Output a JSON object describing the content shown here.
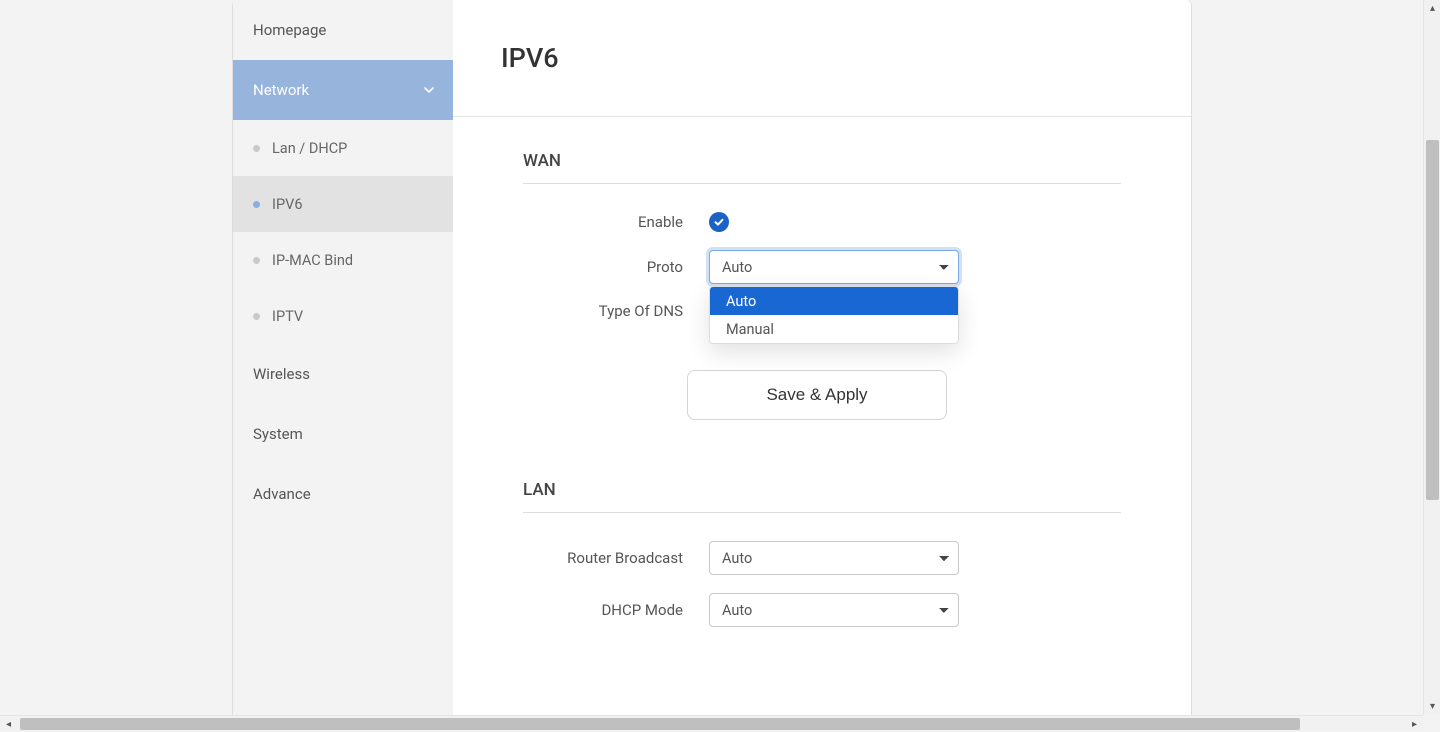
{
  "sidebar": {
    "items": [
      {
        "label": "Homepage",
        "expanded": false
      },
      {
        "label": "Network",
        "expanded": true,
        "children": [
          {
            "label": "Lan / DHCP",
            "active": false
          },
          {
            "label": "IPV6",
            "active": true
          },
          {
            "label": "IP-MAC Bind",
            "active": false
          },
          {
            "label": "IPTV",
            "active": false
          }
        ]
      },
      {
        "label": "Wireless",
        "expanded": false
      },
      {
        "label": "System",
        "expanded": false
      },
      {
        "label": "Advance",
        "expanded": false
      }
    ]
  },
  "page": {
    "title": "IPV6"
  },
  "wan": {
    "section_title": "WAN",
    "enable_label": "Enable",
    "enable_on": true,
    "proto_label": "Proto",
    "proto_selected": "Auto",
    "proto_options": [
      "Auto",
      "Manual"
    ],
    "dns_label": "Type Of DNS",
    "dns_selected": "",
    "save_label": "Save & Apply"
  },
  "lan": {
    "section_title": "LAN",
    "router_broadcast_label": "Router Broadcast",
    "router_broadcast_selected": "Auto",
    "dhcp_mode_label": "DHCP Mode",
    "dhcp_mode_selected": "Auto"
  }
}
